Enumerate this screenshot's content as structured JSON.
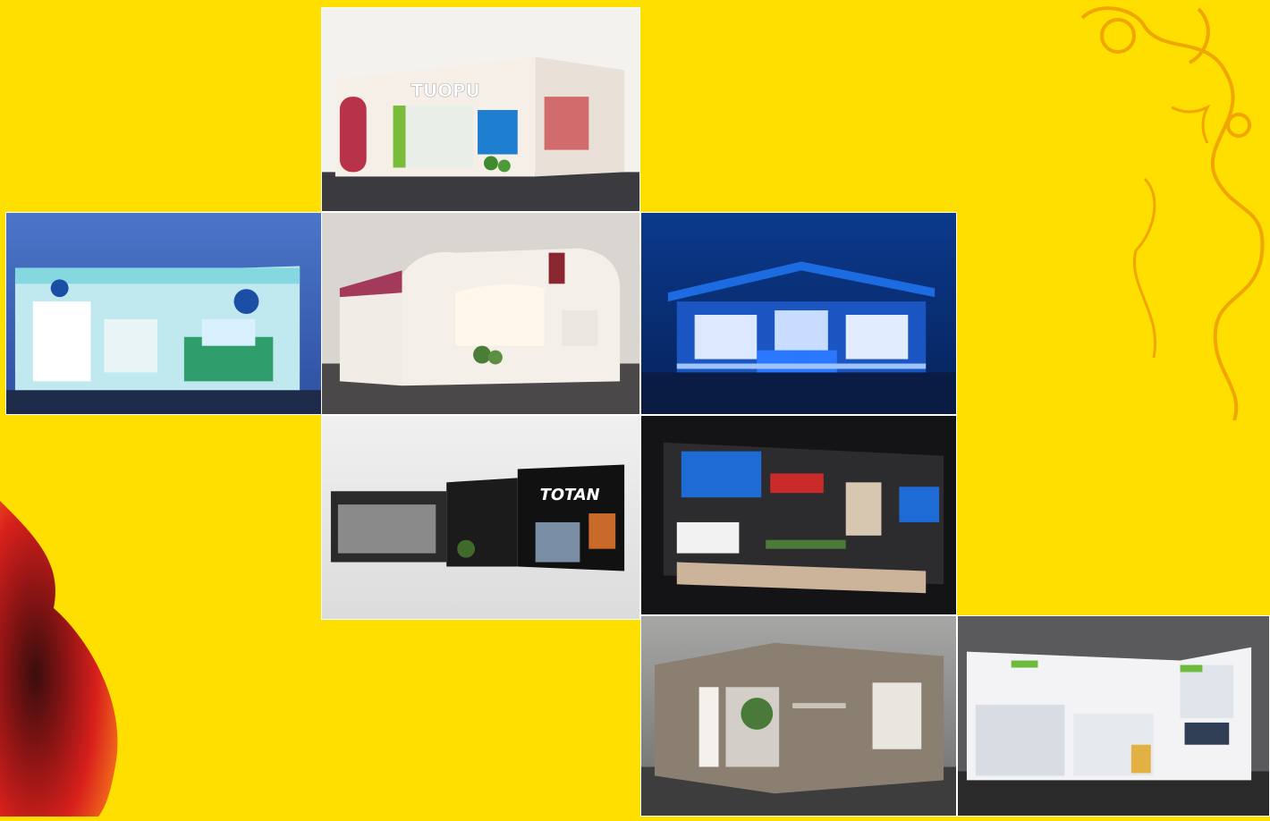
{
  "colors": {
    "background": "#ffdf00",
    "flame": "#c8102e",
    "dragon": "#f0a500"
  },
  "decor": {
    "flame": "flame-decoration",
    "dragon": "dragon-decoration"
  },
  "booths": [
    {
      "id": "tuopu",
      "sign": "TUOPU"
    },
    {
      "id": "teal-booth",
      "sign": ""
    },
    {
      "id": "beige-booth",
      "sign": ""
    },
    {
      "id": "blue-booth",
      "sign": ""
    },
    {
      "id": "black-booth",
      "sign": "TOTAN"
    },
    {
      "id": "dark-booth",
      "sign": ""
    },
    {
      "id": "taupe-booth",
      "sign": ""
    },
    {
      "id": "white-booth",
      "sign": ""
    }
  ]
}
